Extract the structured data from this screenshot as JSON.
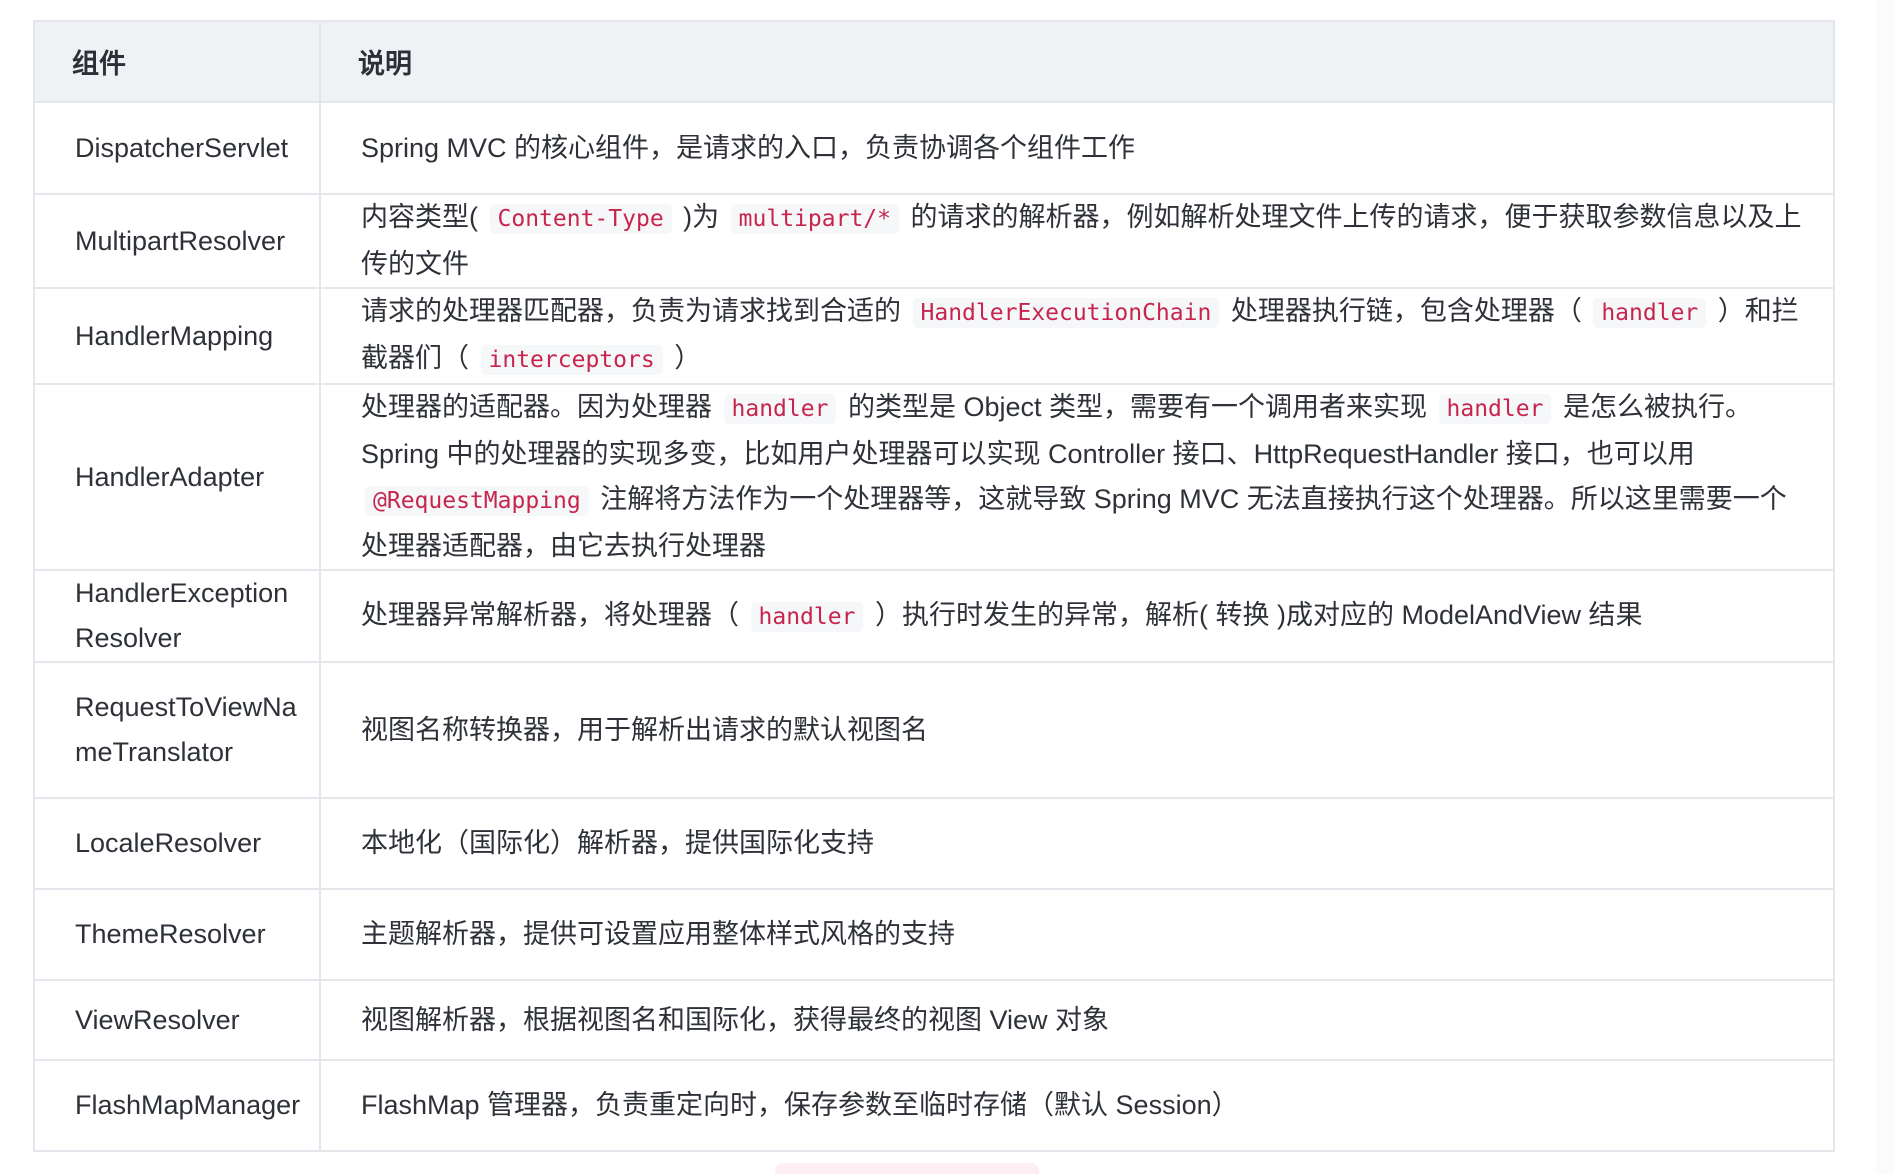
{
  "table": {
    "headers": {
      "component": "组件",
      "description": "说明"
    },
    "rows": [
      {
        "name": "DispatcherServlet",
        "desc": [
          {
            "t": "Spring MVC 的核心组件，是请求的入口，负责协调各个组件工作"
          }
        ]
      },
      {
        "name": "MultipartResolver",
        "desc": [
          {
            "t": "内容类型( "
          },
          {
            "code": "Content-Type"
          },
          {
            "t": " )为 "
          },
          {
            "code": "multipart/*"
          },
          {
            "t": " 的请求的解析器，例如解析处理文件上传的请求，便于获取参数信息以及上传的文件"
          }
        ]
      },
      {
        "name": "HandlerMapping",
        "desc": [
          {
            "t": "请求的处理器匹配器，负责为请求找到合适的 "
          },
          {
            "code": "HandlerExecutionChain"
          },
          {
            "t": " 处理器执行链，包含处理器（ "
          },
          {
            "code": "handler"
          },
          {
            "t": " ）和拦截器们（ "
          },
          {
            "code": "interceptors"
          },
          {
            "t": " ）"
          }
        ]
      },
      {
        "name": "HandlerAdapter",
        "desc": [
          {
            "t": "处理器的适配器。因为处理器 "
          },
          {
            "code": "handler"
          },
          {
            "t": " 的类型是 Object 类型，需要有一个调用者来实现 "
          },
          {
            "code": "handler"
          },
          {
            "t": " 是怎么被执行。Spring 中的处理器的实现多变，比如用户处理器可以实现 Controller 接口、HttpRequestHandler 接口，也可以用 "
          },
          {
            "code": "@RequestMapping"
          },
          {
            "t": " 注解将方法作为一个处理器等，这就导致 Spring MVC 无法直接执行这个处理器。所以这里需要一个处理器适配器，由它去执行处理器"
          }
        ]
      },
      {
        "name": "HandlerExceptionResolver",
        "desc": [
          {
            "t": "处理器异常解析器，将处理器（ "
          },
          {
            "code": "handler"
          },
          {
            "t": " ）执行时发生的异常，解析( 转换 )成对应的 ModelAndView 结果"
          }
        ]
      },
      {
        "name": "RequestToViewNameTranslator",
        "desc": [
          {
            "t": "视图名称转换器，用于解析出请求的默认视图名"
          }
        ]
      },
      {
        "name": "LocaleResolver",
        "desc": [
          {
            "t": "本地化（国际化）解析器，提供国际化支持"
          }
        ]
      },
      {
        "name": "ThemeResolver",
        "desc": [
          {
            "t": "主题解析器，提供可设置应用整体样式风格的支持"
          }
        ]
      },
      {
        "name": "ViewResolver",
        "desc": [
          {
            "t": "视图解析器，根据视图名和国际化，获得最终的视图 View 对象"
          }
        ]
      },
      {
        "name": "FlashMapManager",
        "desc": [
          {
            "t": "FlashMap 管理器，负责重定向时，保存参数至临时存储（默认 Session）"
          }
        ]
      }
    ]
  },
  "colors": {
    "header_bg": "#eff1f4",
    "border": "#e3e6ea",
    "code_text": "#c7254e",
    "code_bg": "#f6f7f9"
  }
}
